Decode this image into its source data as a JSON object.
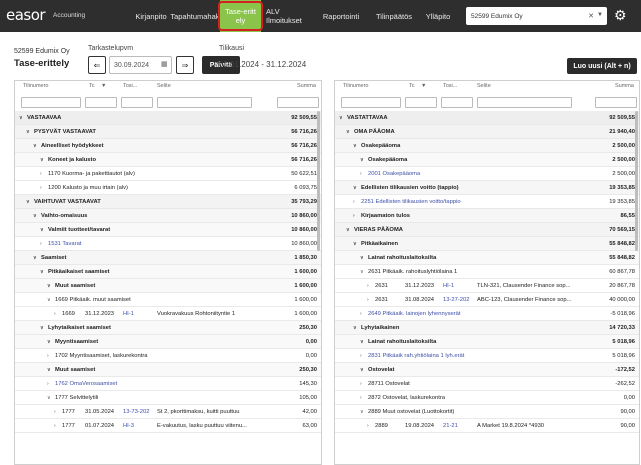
{
  "app": {
    "logo": "easor",
    "logo_sub": "Accounting"
  },
  "nav": {
    "items": [
      "Kirjanpito",
      "Tapahtumahaku",
      "Tase-erittely",
      "ALV Ilmoitukset",
      "Raportointi",
      "Tilinpäätös",
      "Ylläpito"
    ],
    "active": "Tase-erittely",
    "company_select": "52599 Edumix Oy"
  },
  "header": {
    "company": "52599 Edumix Oy",
    "title": "Tase-erittely",
    "date_label": "Tarkastelupvm",
    "date_value": "30.09.2024",
    "show_button": "Päivitä",
    "period_label": "Tilikausi",
    "period_value": "01.01.2024 - 31.12.2024",
    "new_button": "Luo uusi (Alt + n)"
  },
  "columns": {
    "account": "Tilinumero",
    "tc": "Tc",
    "tosi": "Tosi...",
    "selite": "Selite",
    "summa": "Summa"
  },
  "left_rows": [
    {
      "level": "l0",
      "indent": 0,
      "chev": "v",
      "label": "VASTAAVAA",
      "amount": "92 509,55"
    },
    {
      "level": "l1",
      "indent": 1,
      "chev": "v",
      "label": "PYSYVÄT VASTAAVAT",
      "amount": "56 716,26"
    },
    {
      "level": "l2",
      "indent": 2,
      "chev": "v",
      "label": "Aineelliset hyödykkeet",
      "amount": "56 716,26"
    },
    {
      "level": "l3",
      "indent": 3,
      "chev": "v",
      "label": "Koneet ja kalusto",
      "amount": "56 716,26"
    },
    {
      "level": "acc",
      "indent": 3,
      "chev": ">",
      "label": "1170 Kuorma- ja pakettiautot (alv)",
      "amount": "50 622,51"
    },
    {
      "level": "acc",
      "indent": 3,
      "chev": ">",
      "label": "1200 Kalusto ja muu irtain (alv)",
      "amount": "6 093,75"
    },
    {
      "level": "l1",
      "indent": 1,
      "chev": "v",
      "label": "VAIHTUVAT VASTAAVAT",
      "amount": "35 793,29"
    },
    {
      "level": "l2",
      "indent": 2,
      "chev": "v",
      "label": "Vaihto-omaisuus",
      "amount": "10 860,00"
    },
    {
      "level": "l3",
      "indent": 3,
      "chev": "v",
      "label": "Valmiit tuotteet/tavarat",
      "amount": "10 860,00"
    },
    {
      "level": "acc",
      "indent": 3,
      "chev": ">",
      "label": "1531 Tavarat",
      "amount": "10 860,00",
      "link": true
    },
    {
      "level": "l2",
      "indent": 2,
      "chev": "v",
      "label": "Saamiset",
      "amount": "1 850,30"
    },
    {
      "level": "l3",
      "indent": 3,
      "chev": "v",
      "label": "Pitkäaikaiset saamiset",
      "amount": "1 600,00"
    },
    {
      "level": "l3",
      "indent": 4,
      "chev": "v",
      "label": "Muut saamiset",
      "amount": "1 600,00"
    },
    {
      "level": "acc",
      "indent": 4,
      "chev": "v",
      "label": "1669 Pitkäaik. muut saamiset",
      "amount": "1 600,00"
    },
    {
      "level": "tx",
      "indent": 5,
      "chev": ">",
      "label": "1669",
      "date": "31.12.2023",
      "doc": "HI-1",
      "desc": "Vuokravakuus Rohtoniityntie 1",
      "amount": "1 600,00"
    },
    {
      "level": "l3",
      "indent": 3,
      "chev": "v",
      "label": "Lyhytaikaiset saamiset",
      "amount": "250,30"
    },
    {
      "level": "l3",
      "indent": 4,
      "chev": "v",
      "label": "Myyntisaamiset",
      "amount": "0,00"
    },
    {
      "level": "acc",
      "indent": 4,
      "chev": ">",
      "label": "1702 Myyntisaamiset, laskurekontra",
      "amount": "0,00"
    },
    {
      "level": "l3",
      "indent": 4,
      "chev": "v",
      "label": "Muut saamiset",
      "amount": "250,30"
    },
    {
      "level": "acc",
      "indent": 4,
      "chev": ">",
      "label": "1762 OmaVerosaamiset",
      "amount": "145,30",
      "link": true
    },
    {
      "level": "acc",
      "indent": 4,
      "chev": "v",
      "label": "1777 Selvittelytili",
      "amount": "105,00"
    },
    {
      "level": "tx",
      "indent": 5,
      "chev": ">",
      "label": "1777",
      "date": "31.05.2024",
      "doc": "13-73-202",
      "desc": "St 2, pkorttimaksu, kuitti puuttuu",
      "amount": "42,00"
    },
    {
      "level": "tx",
      "indent": 5,
      "chev": ">",
      "label": "1777",
      "date": "01.07.2024",
      "doc": "HI-3",
      "desc": "E-vakuutus, lasku puuttuu viitenu...",
      "amount": "63,00"
    }
  ],
  "right_rows": [
    {
      "level": "l0",
      "indent": 0,
      "chev": "v",
      "label": "VASTATTAVAA",
      "amount": "92 509,55"
    },
    {
      "level": "l1",
      "indent": 1,
      "chev": "v",
      "label": "OMA PÄÄOMA",
      "amount": "21 940,40"
    },
    {
      "level": "l2",
      "indent": 2,
      "chev": "v",
      "label": "Osakepääoma",
      "amount": "2 500,00"
    },
    {
      "level": "l3",
      "indent": 3,
      "chev": "v",
      "label": "Osakepääoma",
      "amount": "2 500,00"
    },
    {
      "level": "acc",
      "indent": 3,
      "chev": ">",
      "label": "2001 Osakepääoma",
      "amount": "2 500,00",
      "link": true
    },
    {
      "level": "l2",
      "indent": 2,
      "chev": "v",
      "label": "Edellisten tilikausien voitto (tappio)",
      "amount": "19 353,85"
    },
    {
      "level": "acc",
      "indent": 2,
      "chev": ">",
      "label": "2251 Edellisten tilikausien voitto/tappio",
      "amount": "19 353,85",
      "link": true
    },
    {
      "level": "l2",
      "indent": 2,
      "chev": ">",
      "label": "Kirjaamaton tulos",
      "amount": "86,55"
    },
    {
      "level": "l1",
      "indent": 1,
      "chev": "v",
      "label": "VIERAS PÄÄOMA",
      "amount": "70 569,15"
    },
    {
      "level": "l2",
      "indent": 2,
      "chev": "v",
      "label": "Pitkäaikainen",
      "amount": "55 848,82"
    },
    {
      "level": "l3",
      "indent": 3,
      "chev": "v",
      "label": "Lainat rahoituslaitoksilta",
      "amount": "55 848,82"
    },
    {
      "level": "acc",
      "indent": 3,
      "chev": "v",
      "label": "2631 Pitkäaik. rahoituslyhtiölaina 1",
      "amount": "60 867,78"
    },
    {
      "level": "tx",
      "indent": 4,
      "chev": ">",
      "label": "2631",
      "date": "31.12.2023",
      "doc": "HI-1",
      "desc": "TLN-321, Clausender Finance sop...",
      "amount": "20 867,78"
    },
    {
      "level": "tx",
      "indent": 4,
      "chev": ">",
      "label": "2631",
      "date": "31.08.2024",
      "doc": "13-27-202",
      "desc": "ABC-123, Clausender Finance sop...",
      "amount": "40 000,00"
    },
    {
      "level": "acc",
      "indent": 3,
      "chev": ">",
      "label": "2649 Pitkäaik. lainojen lyhennyserät",
      "amount": "-5 018,96",
      "link": true
    },
    {
      "level": "l2",
      "indent": 2,
      "chev": "v",
      "label": "Lyhytaikainen",
      "amount": "14 720,33"
    },
    {
      "level": "l3",
      "indent": 3,
      "chev": "v",
      "label": "Lainat rahoituslaitoksilta",
      "amount": "5 018,96"
    },
    {
      "level": "acc",
      "indent": 3,
      "chev": ">",
      "label": "2831 Pitkäaik rah.yhtiölaina 1 lyh.erät",
      "amount": "5 018,96",
      "link": true
    },
    {
      "level": "l3",
      "indent": 3,
      "chev": "v",
      "label": "Ostovelat",
      "amount": "-172,52"
    },
    {
      "level": "acc",
      "indent": 3,
      "chev": ">",
      "label": "28711 Ostovelat",
      "amount": "-262,52"
    },
    {
      "level": "acc",
      "indent": 3,
      "chev": ">",
      "label": "2872 Ostovelat, laskurekontra",
      "amount": "0,00"
    },
    {
      "level": "acc",
      "indent": 3,
      "chev": "v",
      "label": "2889 Muut ostovelat (Luottokortit)",
      "amount": "90,00"
    },
    {
      "level": "tx",
      "indent": 4,
      "chev": ">",
      "label": "2889",
      "date": "19.08.2024",
      "doc": "21-21",
      "desc": "A Market 19.8.2024 *4930",
      "amount": "90,00"
    }
  ]
}
